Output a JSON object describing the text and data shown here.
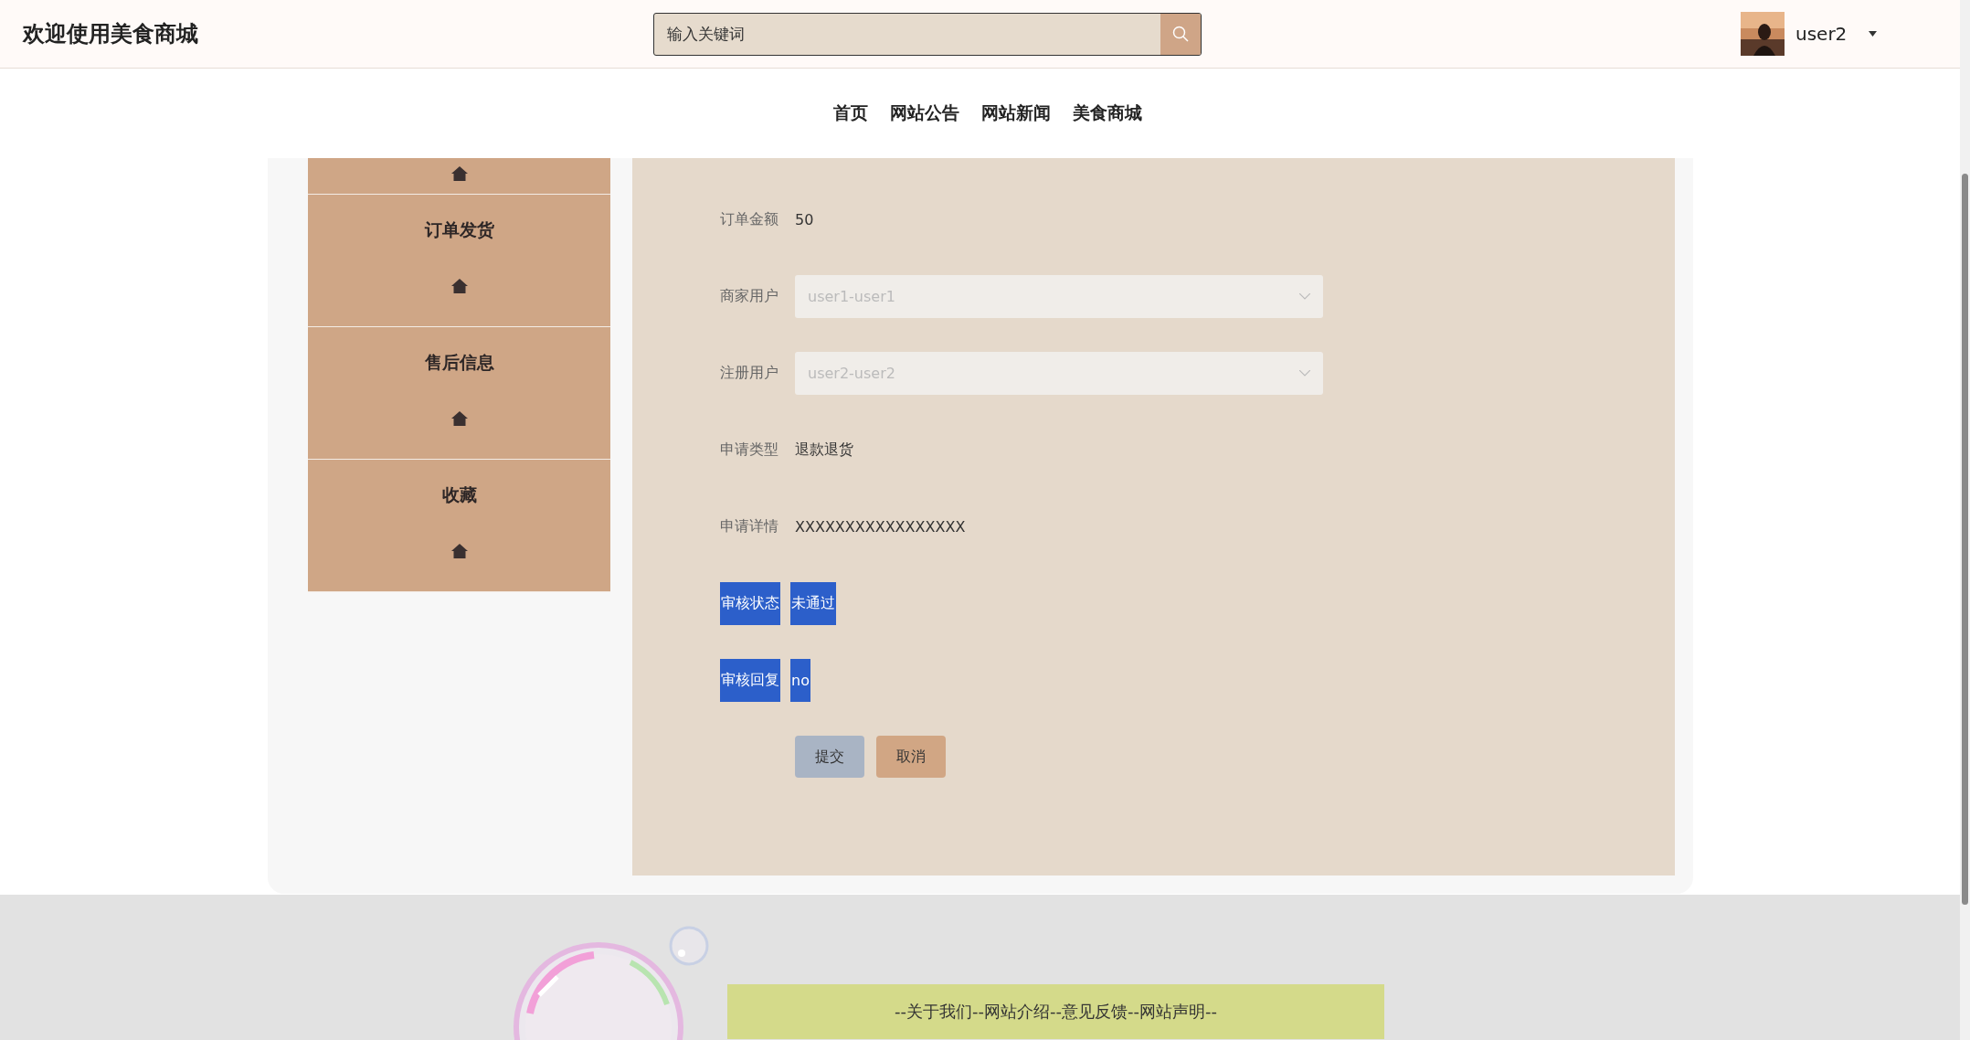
{
  "header": {
    "title": "欢迎使用美食商城",
    "search": {
      "placeholder": "输入关键词"
    },
    "user": "user2"
  },
  "nav": {
    "items": [
      {
        "label": "首页"
      },
      {
        "label": "网站公告"
      },
      {
        "label": "网站新闻"
      },
      {
        "label": "美食商城"
      }
    ]
  },
  "sidebar": {
    "items": [
      {
        "label": "订单发货"
      },
      {
        "label": "售后信息"
      },
      {
        "label": "收藏"
      }
    ]
  },
  "form": {
    "fields": [
      {
        "kind": "text",
        "label": "订单金额",
        "value": "50"
      },
      {
        "kind": "select",
        "label": "商家用户",
        "value": "user1-user1",
        "disabled": true
      },
      {
        "kind": "select",
        "label": "注册用户",
        "value": "user2-user2",
        "disabled": true
      },
      {
        "kind": "text",
        "label": "申请类型",
        "value": "退款退货"
      },
      {
        "kind": "text",
        "label": "申请详情",
        "value": "XXXXXXXXXXXXXXXXX"
      },
      {
        "kind": "tag",
        "label": "审核状态",
        "value": "未通过"
      },
      {
        "kind": "tag",
        "label": "审核回复",
        "value": "no"
      }
    ],
    "buttons": [
      {
        "kind": "submit",
        "label": "提交"
      },
      {
        "kind": "cancel",
        "label": "取消"
      }
    ]
  },
  "footer": {
    "links": "--关于我们--网站介绍--意见反馈--网站声明--"
  }
}
